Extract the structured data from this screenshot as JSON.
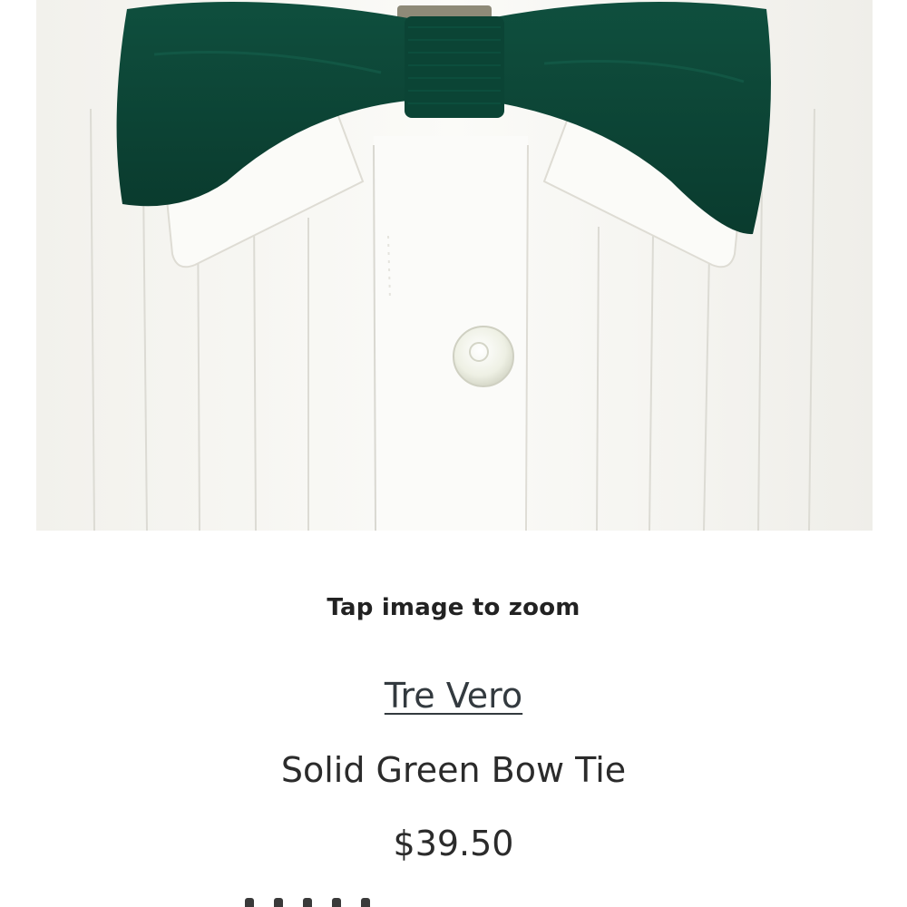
{
  "product": {
    "image_alt": "Solid Green Bow Tie on a pleated white tuxedo shirt",
    "zoom_hint": "Tap image to zoom",
    "brand": "Tre Vero",
    "name": "Solid Green Bow Tie",
    "price": "$39.50"
  },
  "colors": {
    "bow_tie": "#0f4a3a",
    "shirt": "#f5f4f0",
    "text": "#2b2b2b",
    "brand_link": "#333a3f"
  }
}
